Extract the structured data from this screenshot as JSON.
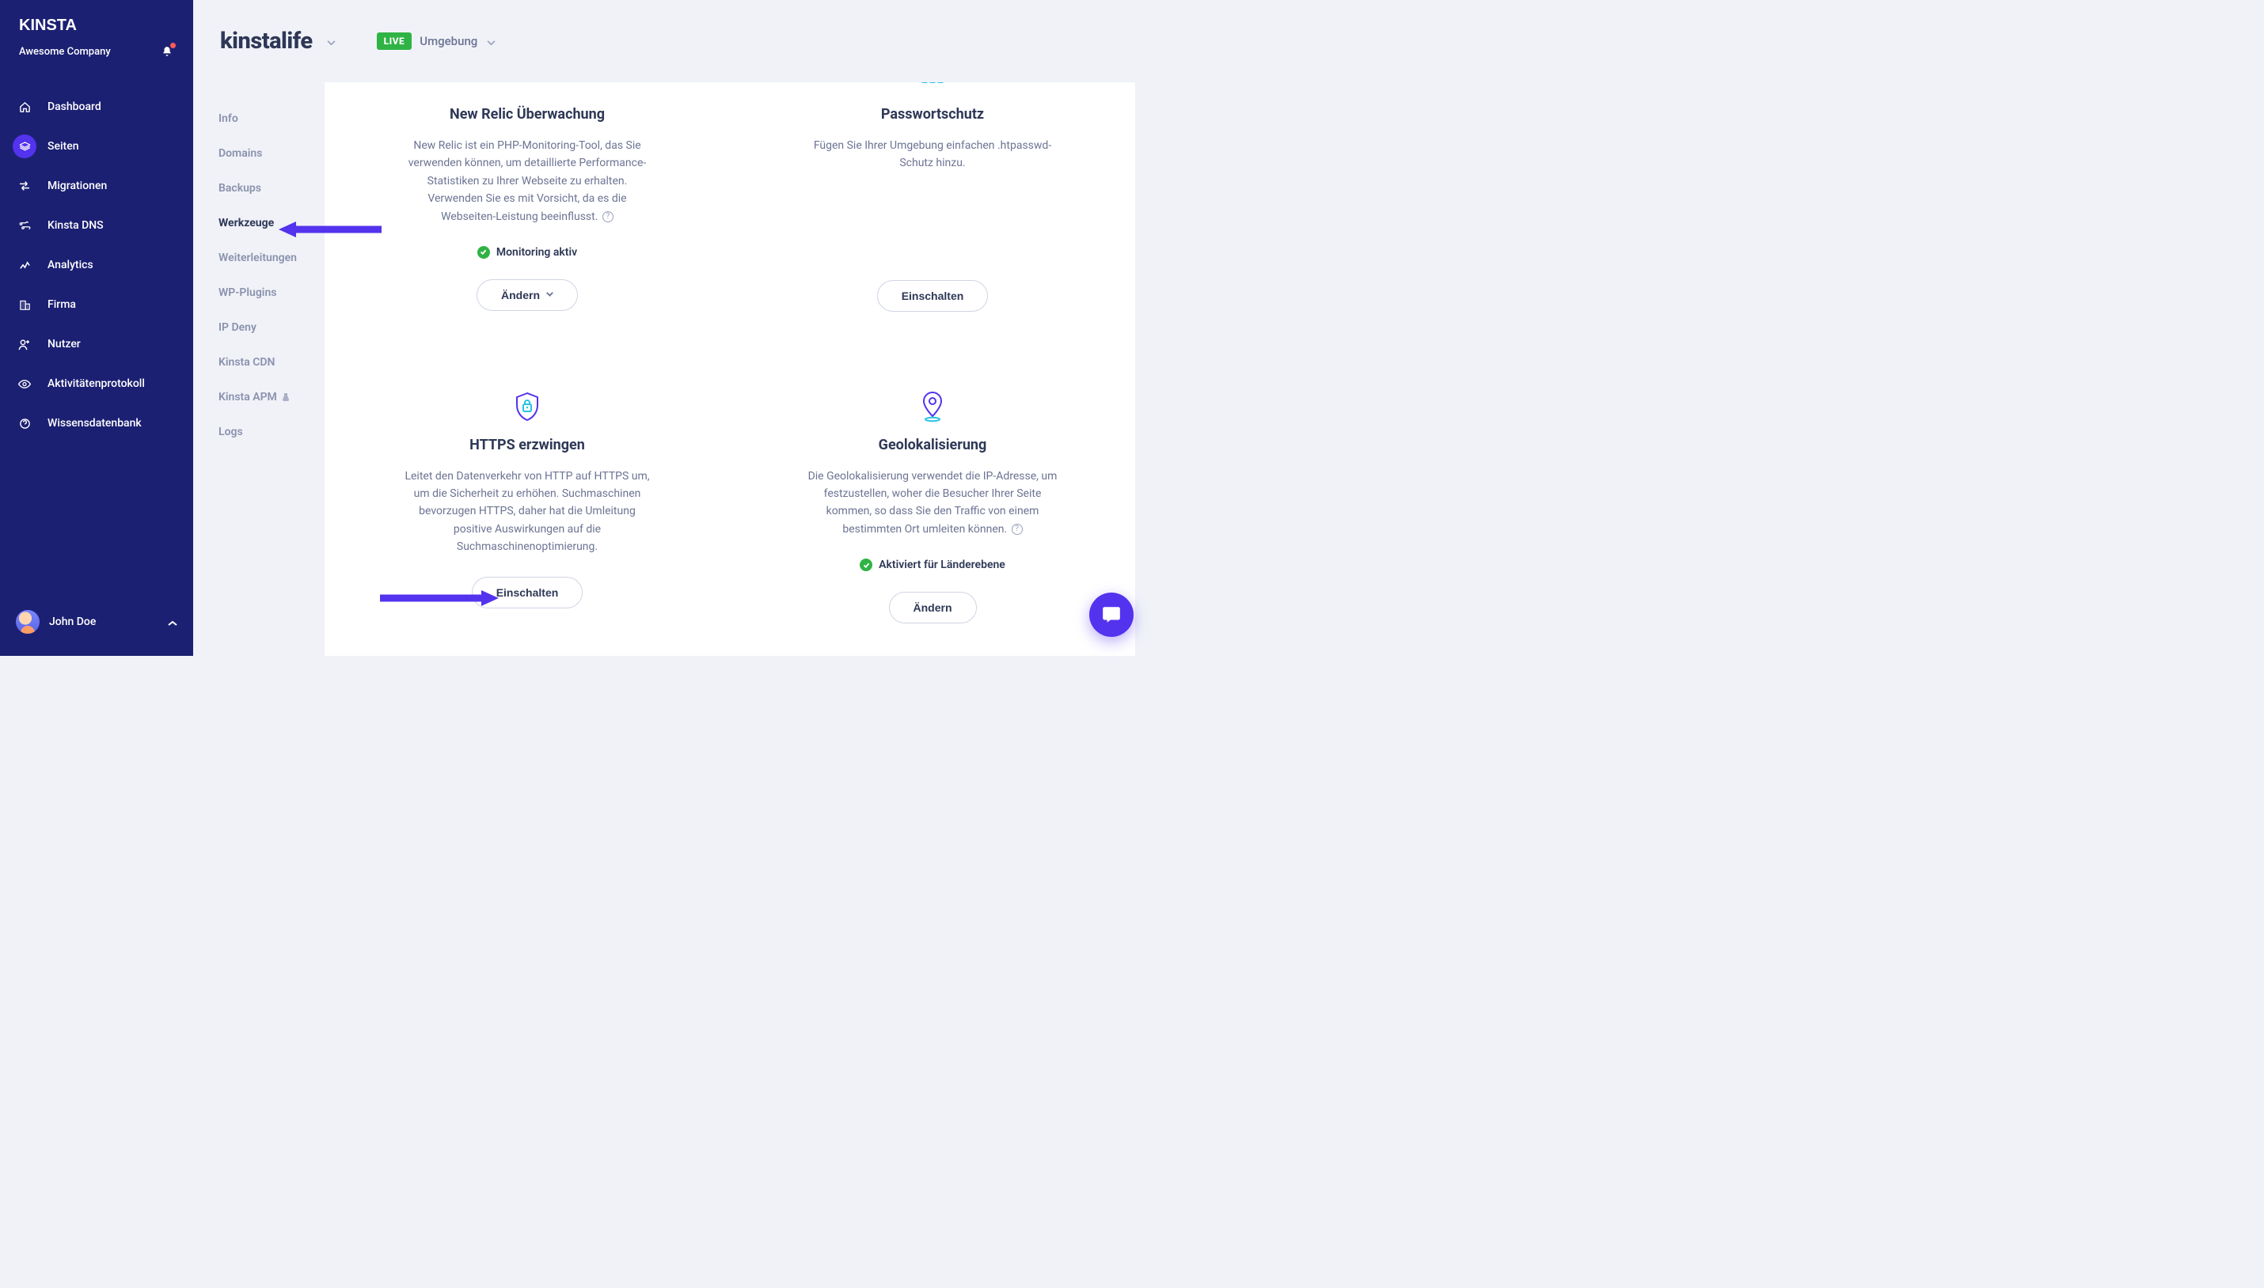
{
  "brand": "KINSTA",
  "company": "Awesome Company",
  "user": {
    "name": "John Doe"
  },
  "nav": [
    {
      "key": "dashboard",
      "label": "Dashboard",
      "active": false
    },
    {
      "key": "seiten",
      "label": "Seiten",
      "active": true
    },
    {
      "key": "migrationen",
      "label": "Migrationen",
      "active": false
    },
    {
      "key": "kinsta-dns",
      "label": "Kinsta DNS",
      "active": false
    },
    {
      "key": "analytics",
      "label": "Analytics",
      "active": false
    },
    {
      "key": "firma",
      "label": "Firma",
      "active": false
    },
    {
      "key": "nutzer",
      "label": "Nutzer",
      "active": false
    },
    {
      "key": "aktivitaeten",
      "label": "Aktivitätenprotokoll",
      "active": false
    },
    {
      "key": "wissensdatenbank",
      "label": "Wissensdatenbank",
      "active": false
    }
  ],
  "header": {
    "site_name": "kinstalife",
    "live_badge": "LIVE",
    "env_label": "Umgebung"
  },
  "subnav": [
    {
      "key": "info",
      "label": "Info"
    },
    {
      "key": "domains",
      "label": "Domains"
    },
    {
      "key": "backups",
      "label": "Backups"
    },
    {
      "key": "werkzeuge",
      "label": "Werkzeuge",
      "active": true
    },
    {
      "key": "weiterleitungen",
      "label": "Weiterleitungen"
    },
    {
      "key": "wp-plugins",
      "label": "WP-Plugins"
    },
    {
      "key": "ip-deny",
      "label": "IP Deny"
    },
    {
      "key": "kinsta-cdn",
      "label": "Kinsta CDN"
    },
    {
      "key": "kinsta-apm",
      "label": "Kinsta APM",
      "beta": true
    },
    {
      "key": "logs",
      "label": "Logs"
    }
  ],
  "cards": {
    "new_relic": {
      "title": "New Relic Überwachung",
      "desc": "New Relic ist ein PHP-Monitoring-Tool, das Sie verwenden können, um detaillierte Performance-Statistiken zu Ihrer Webseite zu erhalten. Verwenden Sie es mit Vorsicht, da es die Webseiten-Leistung beeinflusst.",
      "status": "Monitoring aktiv",
      "button": "Ändern"
    },
    "passwortschutz": {
      "title": "Passwortschutz",
      "desc": "Fügen Sie Ihrer Umgebung einfachen .htpasswd-Schutz hinzu.",
      "button": "Einschalten"
    },
    "https": {
      "title": "HTTPS erzwingen",
      "desc": "Leitet den Datenverkehr von HTTP auf HTTPS um, um die Sicherheit zu erhöhen. Suchmaschinen bevorzugen HTTPS, daher hat die Umleitung positive Auswirkungen auf die Suchmaschinenoptimierung.",
      "button": "Einschalten"
    },
    "geo": {
      "title": "Geolokalisierung",
      "desc": "Die Geolokalisierung verwendet die IP-Adresse, um festzustellen, woher die Besucher Ihrer Seite kommen, so dass Sie den Traffic von einem bestimmten Ort umleiten können.",
      "status": "Aktiviert für Länderebene",
      "button": "Ändern"
    }
  },
  "colors": {
    "accent": "#5333ed",
    "navy": "#1c2072",
    "green": "#2fb344",
    "cyan": "#29c3e5"
  }
}
